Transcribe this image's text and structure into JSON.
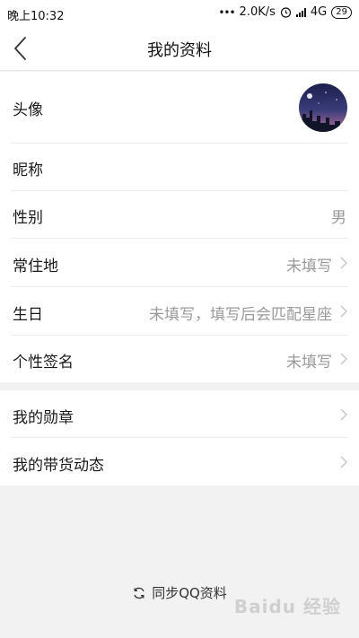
{
  "status_bar": {
    "time": "晚上10:32",
    "network_speed": "2.0K/s",
    "network_type": "4G",
    "battery": "29"
  },
  "nav": {
    "title": "我的资料",
    "back_icon": "chevron-left-icon"
  },
  "profile_rows": [
    {
      "label": "头像",
      "value": ""
    },
    {
      "label": "昵称",
      "value": ""
    },
    {
      "label": "性别",
      "value": "男"
    },
    {
      "label": "常住地",
      "value": "未填写"
    },
    {
      "label": "生日",
      "value": "未填写，填写后会匹配星座"
    },
    {
      "label": "个性签名",
      "value": "未填写"
    }
  ],
  "extra_rows": [
    {
      "label": "我的勋章"
    },
    {
      "label": "我的带货动态"
    }
  ],
  "sync_label": "同步QQ资料",
  "watermark": "Baidu 经验",
  "colors": {
    "background": "#f2f2f2",
    "row_bg": "#ffffff",
    "value_text": "#999999",
    "chevron": "#c8c8c8"
  }
}
